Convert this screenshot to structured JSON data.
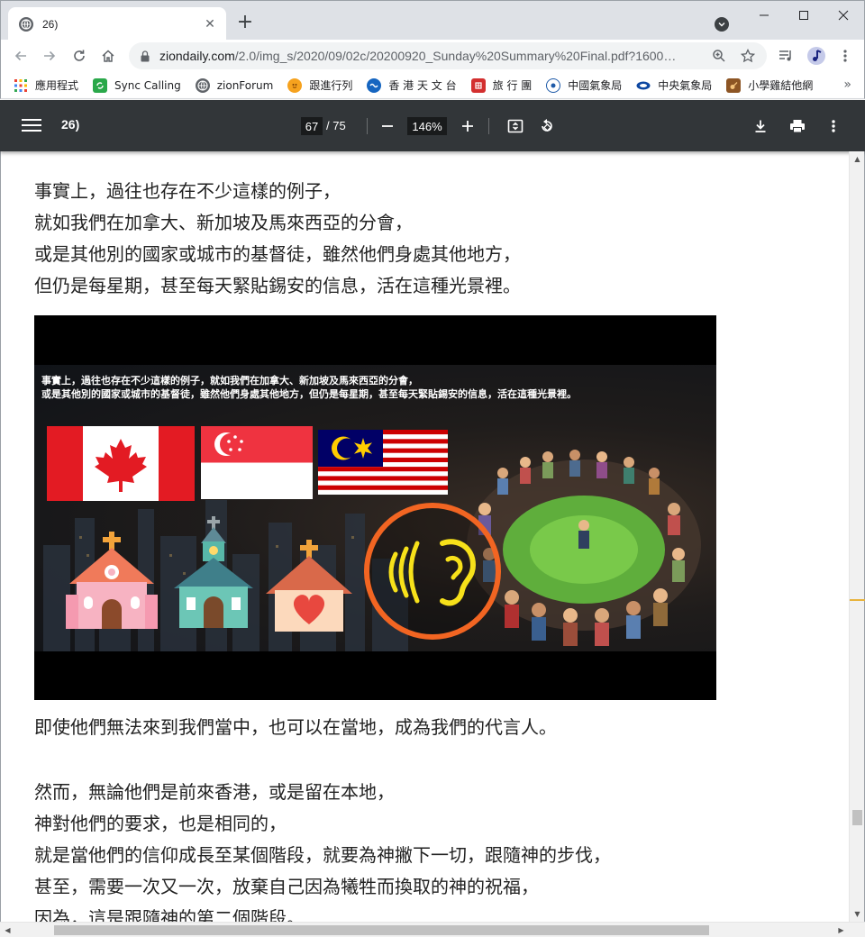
{
  "browser": {
    "tab_title": "26)",
    "new_tab_symbol": "+",
    "tab_close_symbol": "✕",
    "url_host": "ziondaily.com",
    "url_path": "/2.0/img_s/2020/09/02c/20200920_Sunday%20Summary%20Final.pdf?1600…",
    "icons": [
      "back-arrow-icon",
      "forward-arrow-icon",
      "reload-icon",
      "home-icon",
      "lock-icon",
      "zoom-icon",
      "star-icon",
      "media-control-icon",
      "profile-icon",
      "kebab-menu-icon"
    ]
  },
  "bookmarks": [
    {
      "label": "應用程式",
      "icon": "apps-grid-icon",
      "color": "#ea4335"
    },
    {
      "label": "Sync Calling",
      "icon": "sync-calling-icon",
      "color": "#2aa84a"
    },
    {
      "label": "zionForum",
      "icon": "globe-icon",
      "color": "#5f6368"
    },
    {
      "label": "跟進行列",
      "icon": "follow-up-icon",
      "color": "#f6a21e"
    },
    {
      "label": "香 港 天 文 台",
      "icon": "observatory-icon",
      "color": "#1565c0"
    },
    {
      "label": "旅 行 團",
      "icon": "travel-icon",
      "color": "#d32f2f"
    },
    {
      "label": "中國氣象局",
      "icon": "china-weather-icon",
      "color": "#1e5aa8"
    },
    {
      "label": "中央氣象局",
      "icon": "central-weather-icon",
      "color": "#0d47a1"
    },
    {
      "label": "小學雞結他網",
      "icon": "guitar-icon",
      "color": "#8d5524"
    }
  ],
  "bookmarks_more": "»",
  "pdf": {
    "title": "26)",
    "current_page": "67",
    "total_pages": "/ 75",
    "zoom": "146%",
    "zoom_out": "−",
    "zoom_in": "+"
  },
  "content": {
    "para1": [
      "事實上，過往也存在不少這樣的例子，",
      "就如我們在加拿大、新加坡及馬來西亞的分會，",
      "或是其他別的國家或城市的基督徒，雖然他們身處其他地方，",
      "但仍是每星期，甚至每天緊貼錫安的信息，活在這種光景裡。"
    ],
    "slide_caption": [
      "事實上，過往也存在不少這樣的例子，就如我們在加拿大、新加坡及馬來西亞的分會，",
      "或是其他別的國家或城市的基督徒，雖然他們身處其他地方，但仍是每星期，甚至每天緊貼錫安的信息，活在這種光景裡。"
    ],
    "para2": "即使他們無法來到我們當中，也可以在當地，成為我們的代言人。",
    "para3": [
      "然而，無論他們是前來香港，或是留在本地，",
      "神對他們的要求，也是相同的，",
      "就是當他們的信仰成長至某個階段，就要為神撇下一切，跟隨神的步伐，",
      "甚至，需要一次又一次，放棄自己因為犧牲而換取的神的祝福，",
      "因為，這是跟隨神的第二個階段。"
    ]
  }
}
